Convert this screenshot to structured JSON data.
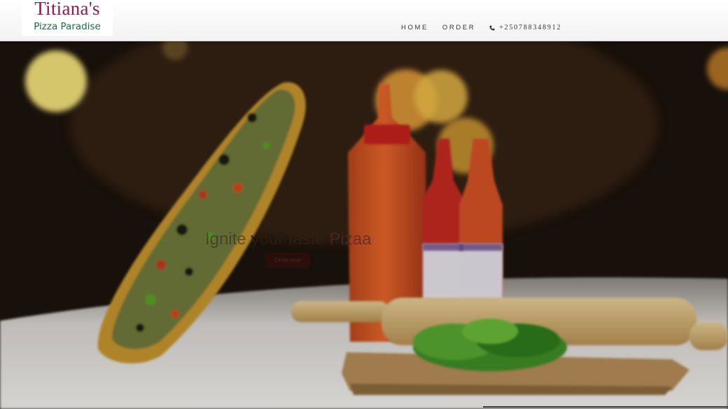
{
  "header": {
    "logo": {
      "title": "Titiana's",
      "subtitle": "Pizza Paradise"
    },
    "nav": {
      "items": [
        {
          "label": "HOME"
        },
        {
          "label": "ORDER"
        }
      ],
      "phone": {
        "icon": "phone-icon",
        "number": "+250788348912"
      }
    }
  },
  "hero": {
    "heading": {
      "word1": "Ignite",
      "word2": "your",
      "word3": "taste",
      "word4": "Pizaa"
    },
    "button_label": "Order now",
    "background_image": "pizza-and-sauce-bottles-photo"
  },
  "colors": {
    "logo_title": "#8a1e47",
    "logo_subtitle": "#1f6a4a",
    "nav_text": "#333333",
    "hero_button": "#2a0e0c"
  }
}
